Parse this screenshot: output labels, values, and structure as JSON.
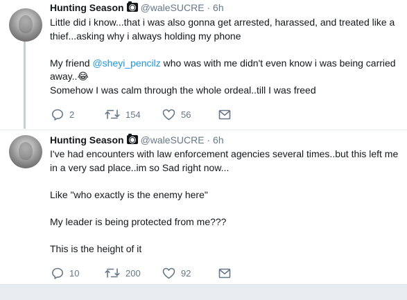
{
  "tweets": [
    {
      "name": "Hunting Season",
      "handle": "@waleSUCRE",
      "dot": "·",
      "time": "6h",
      "body_line1": "Little did i know...that i was also gonna get arrested, harassed, and treated like a thief...asking why i always holding my phone",
      "body_line2_prefix": "My friend ",
      "mention": "@sheyi_pencilz",
      "body_line2_suffix": " who was with me didn't even know i was being carried away..",
      "emoji": "😂",
      "body_line3": "Somehow I was calm through the whole ordeal..till I was freed",
      "actions": {
        "replies": "2",
        "retweets": "154",
        "likes": "56"
      }
    },
    {
      "name": "Hunting Season",
      "handle": "@waleSUCRE",
      "dot": "·",
      "time": "6h",
      "body_line1": "I've had encounters with law enforcement agencies several times..but this left me in a very sad place..im so Sad right now...",
      "body_line2": "Like \"who exactly is the enemy here\"",
      "body_line3": "My leader is being protected from me???",
      "body_line4": "This is the height of it",
      "actions": {
        "replies": "10",
        "retweets": "200",
        "likes": "92"
      }
    }
  ],
  "icons": {
    "reply": "reply-icon",
    "retweet": "retweet-icon",
    "like": "heart-icon",
    "dm": "direct-message-icon",
    "badge": "camera-icon"
  },
  "colors": {
    "mention": "#1b95e0",
    "meta": "#657786",
    "text": "#14171a",
    "thread": "#c4cfd6"
  }
}
